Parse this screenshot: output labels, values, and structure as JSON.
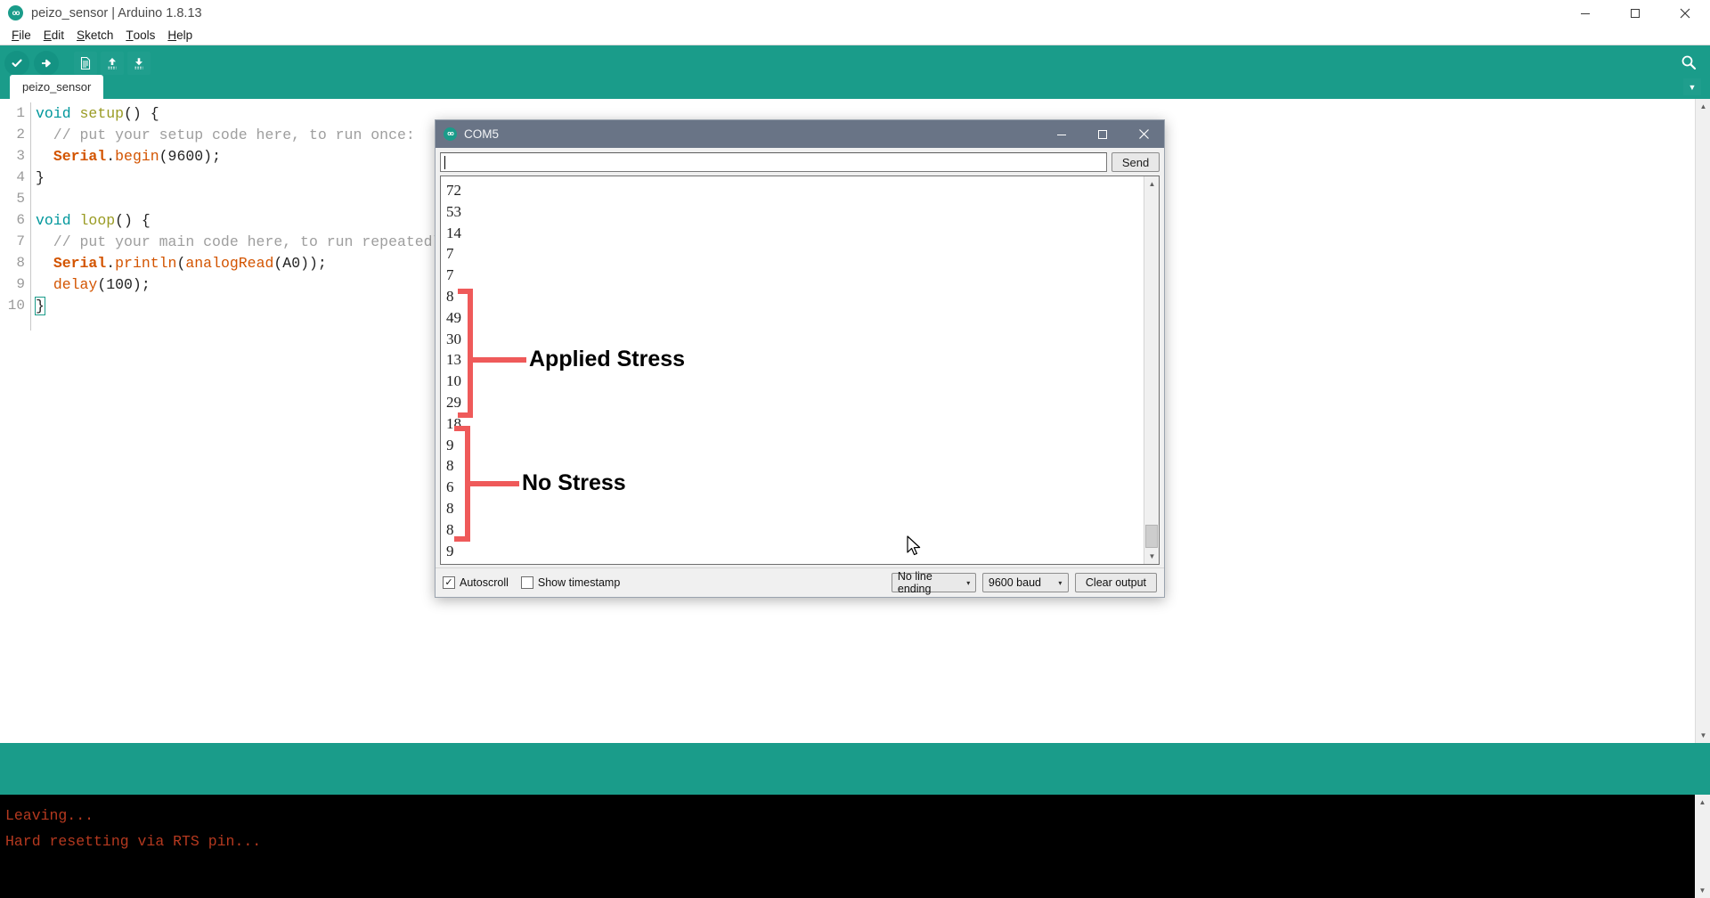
{
  "window": {
    "title": "peizo_sensor | Arduino 1.8.13",
    "logo_text": "oo",
    "minimize": "–",
    "maximize": "☐",
    "close": "✕"
  },
  "menubar": {
    "items": [
      {
        "label": "File",
        "accel": "F"
      },
      {
        "label": "Edit",
        "accel": "E"
      },
      {
        "label": "Sketch",
        "accel": "S"
      },
      {
        "label": "Tools",
        "accel": "T"
      },
      {
        "label": "Help",
        "accel": "H"
      }
    ]
  },
  "toolbar": {
    "verify": "verify-checkmark-icon",
    "upload": "upload-arrow-icon",
    "new": "new-file-icon",
    "open": "open-folder-up-icon",
    "save": "save-down-icon",
    "serial_monitor": "serial-monitor-magnifier-icon"
  },
  "tabs": {
    "active": "peizo_sensor",
    "menu_arrow": "▼"
  },
  "editor": {
    "lines": [
      {
        "n": "1",
        "segments": [
          {
            "t": "void ",
            "c": "kw"
          },
          {
            "t": "setup",
            "c": "fn"
          },
          {
            "t": "() {",
            "c": "num"
          }
        ]
      },
      {
        "n": "2",
        "segments": [
          {
            "t": "  // put your setup code here, to run once:",
            "c": "cmt"
          }
        ]
      },
      {
        "n": "3",
        "segments": [
          {
            "t": "  ",
            "c": "num"
          },
          {
            "t": "Serial",
            "c": "lib"
          },
          {
            "t": ".",
            "c": "num"
          },
          {
            "t": "begin",
            "c": "mth"
          },
          {
            "t": "(9600);",
            "c": "num"
          }
        ]
      },
      {
        "n": "4",
        "segments": [
          {
            "t": "}",
            "c": "num"
          }
        ]
      },
      {
        "n": "5",
        "segments": [
          {
            "t": "",
            "c": "num"
          }
        ]
      },
      {
        "n": "6",
        "segments": [
          {
            "t": "void ",
            "c": "kw"
          },
          {
            "t": "loop",
            "c": "fn"
          },
          {
            "t": "() {",
            "c": "num"
          }
        ]
      },
      {
        "n": "7",
        "segments": [
          {
            "t": "  // put your main code here, to run repeatedly:",
            "c": "cmt"
          }
        ]
      },
      {
        "n": "8",
        "segments": [
          {
            "t": "  ",
            "c": "num"
          },
          {
            "t": "Serial",
            "c": "lib"
          },
          {
            "t": ".",
            "c": "num"
          },
          {
            "t": "println",
            "c": "mth"
          },
          {
            "t": "(",
            "c": "num"
          },
          {
            "t": "analogRead",
            "c": "mth"
          },
          {
            "t": "(A0));",
            "c": "num"
          }
        ]
      },
      {
        "n": "9",
        "segments": [
          {
            "t": "  ",
            "c": "num"
          },
          {
            "t": "delay",
            "c": "mth"
          },
          {
            "t": "(100);",
            "c": "num"
          }
        ]
      },
      {
        "n": "10",
        "segments": [
          {
            "t": "}",
            "c": "caret"
          }
        ]
      }
    ]
  },
  "console": {
    "lines": [
      "Leaving...",
      "Hard resetting via RTS pin..."
    ]
  },
  "serial_monitor": {
    "title": "COM5",
    "logo_text": "oo",
    "minimize": "–",
    "maximize": "☐",
    "close": "✕",
    "input_value": "",
    "input_placeholder": "",
    "send_label": "Send",
    "output_values": [
      "72",
      "53",
      "14",
      "7",
      "7",
      "8",
      "49",
      "30",
      "13",
      "10",
      "29",
      "18",
      "9",
      "8",
      "6",
      "8",
      "8",
      "9"
    ],
    "autoscroll_label": "Autoscroll",
    "autoscroll_checked": true,
    "timestamp_label": "Show timestamp",
    "timestamp_checked": false,
    "line_ending": "No line ending",
    "baud_rate": "9600 baud",
    "clear_label": "Clear output",
    "dropdown_arrow": "▾"
  },
  "annotations": {
    "color": "#ef5a5a",
    "items": [
      {
        "label": "Applied Stress",
        "font_size": 24
      },
      {
        "label": "No Stress",
        "font_size": 24
      }
    ]
  },
  "scrollbar": {
    "up_arrow": "▲",
    "down_arrow": "▼"
  }
}
